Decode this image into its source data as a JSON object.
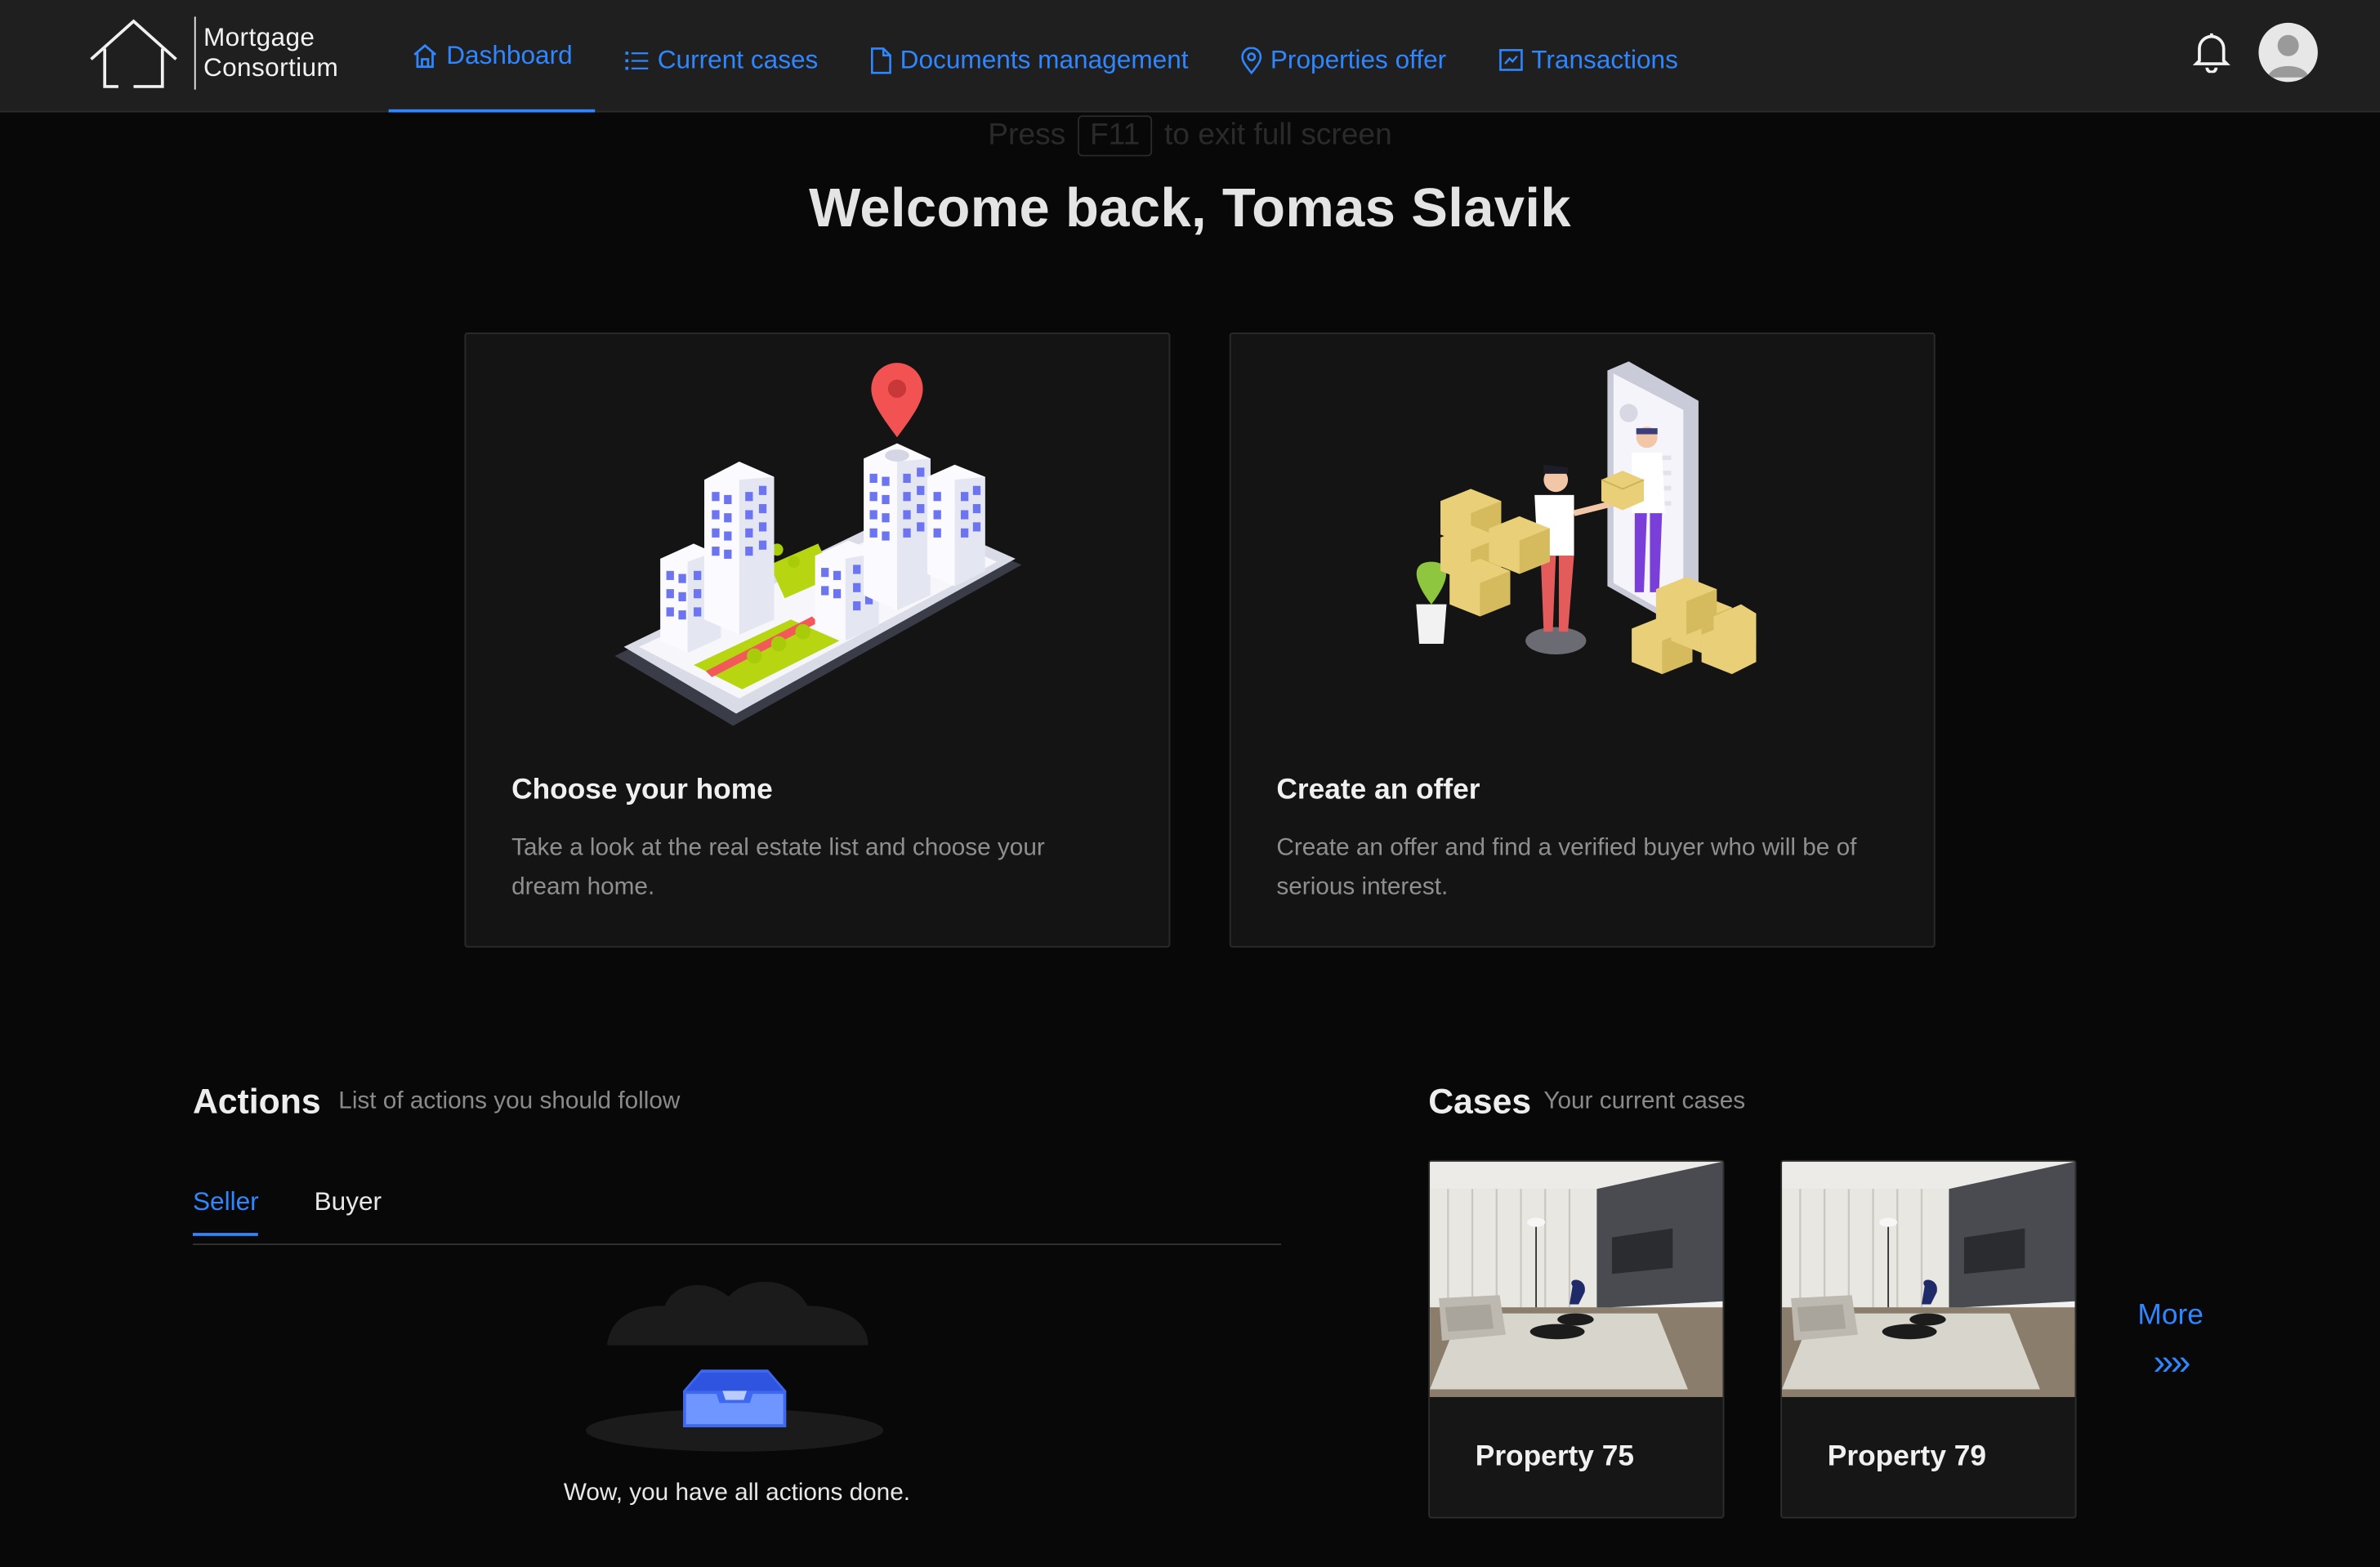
{
  "app": {
    "logo_line1": "Mortgage",
    "logo_line2": "Consortium",
    "accent": "#2f86ff"
  },
  "nav": {
    "items": [
      {
        "label": "Dashboard",
        "icon": "home-icon",
        "active": true
      },
      {
        "label": "Current cases",
        "icon": "list-icon"
      },
      {
        "label": "Documents management",
        "icon": "document-icon"
      },
      {
        "label": "Properties offer",
        "icon": "location-pin-icon"
      },
      {
        "label": "Transactions",
        "icon": "transactions-icon"
      }
    ],
    "bell_icon": "bell-icon",
    "avatar_icon": "user-avatar-icon"
  },
  "fullscreen_hint": {
    "before": "Press",
    "key": "F11",
    "after": "to exit full screen"
  },
  "welcome": "Welcome back, Tomas Slavik",
  "cards": [
    {
      "title": "Choose your home",
      "text": "Take a look at the real estate list and choose your dream home."
    },
    {
      "title": "Create an offer",
      "text": "Create an offer and find a verified buyer who will be of serious interest."
    }
  ],
  "actions": {
    "title": "Actions",
    "subtitle": "List of actions you should follow",
    "tabs": [
      "Seller",
      "Buyer"
    ],
    "empty_text": "Wow, you have all actions done."
  },
  "cases": {
    "title": "Cases",
    "subtitle": "Your current cases",
    "items": [
      {
        "name": "Property 75"
      },
      {
        "name": "Property 79"
      }
    ],
    "more_label": "More",
    "more_glyph": "»»"
  }
}
